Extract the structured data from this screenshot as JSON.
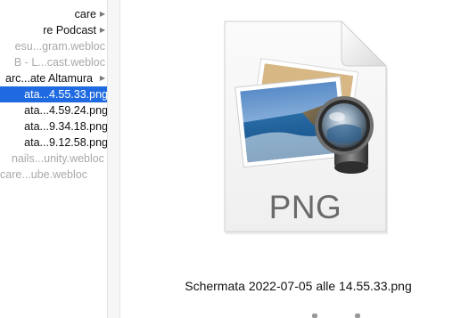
{
  "file_list": [
    {
      "text": "care",
      "arrow": true,
      "dim": false,
      "selected": false
    },
    {
      "text": "re Podcast",
      "arrow": true,
      "dim": false,
      "selected": false
    },
    {
      "text": "esu...gram.webloc",
      "arrow": false,
      "dim": true,
      "selected": false
    },
    {
      "text": "B - L...cast.webloc",
      "arrow": false,
      "dim": true,
      "selected": false
    },
    {
      "text": "arc...ate Altamura",
      "arrow": true,
      "dim": false,
      "selected": false
    },
    {
      "text": "ata...4.55.33.png",
      "arrow": false,
      "dim": false,
      "selected": true
    },
    {
      "text": "ata...4.59.24.png",
      "arrow": false,
      "dim": false,
      "selected": false
    },
    {
      "text": "ata...9.34.18.png",
      "arrow": false,
      "dim": false,
      "selected": false
    },
    {
      "text": "ata...9.12.58.png",
      "arrow": false,
      "dim": false,
      "selected": false
    },
    {
      "text": "nails...unity.webloc",
      "arrow": false,
      "dim": true,
      "selected": false
    },
    {
      "text": "care...ube.webloc",
      "arrow": false,
      "dim": true,
      "selected": false
    }
  ],
  "arrow_glyph": "▶",
  "preview": {
    "file_type_label": "PNG",
    "file_name": "Schermata 2022-07-05 alle 14.55.33.png",
    "icon": "png-document-icon"
  },
  "colors": {
    "selection": "#1f6ae0",
    "dim_text": "#a9a9a9"
  }
}
